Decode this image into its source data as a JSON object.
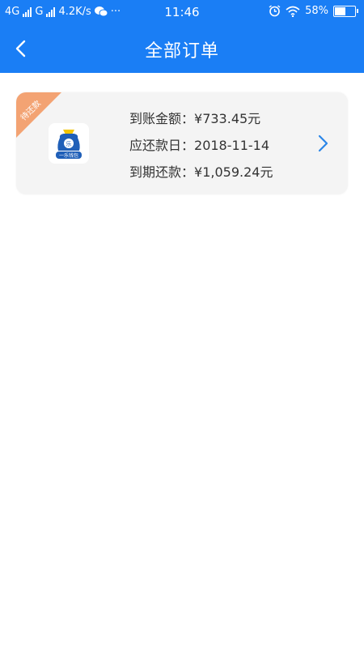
{
  "status_bar": {
    "network1": "4G",
    "network2": "G",
    "speed": "4.2K/s",
    "dots": "···",
    "time": "11:46",
    "battery": "58%",
    "battery_level": 0.58
  },
  "header": {
    "title": "全部订单"
  },
  "order": {
    "tag": "待还款",
    "logo_text": "一乐钱包",
    "arrival_label": "到账金额：",
    "arrival_value": "¥733.45元",
    "due_date_label": "应还款日：",
    "due_date_value": "2018-11-14",
    "due_amount_label": "到期还款：",
    "due_amount_value": "¥1,059.24元"
  },
  "colors": {
    "primary": "#1a7ef5",
    "tag": "#f3a373",
    "card_bg": "#f4f4f4"
  },
  "icons": [
    "back-arrow-icon",
    "alarm-icon",
    "wifi-icon",
    "wechat-icon",
    "battery-icon",
    "chevron-right-icon"
  ]
}
